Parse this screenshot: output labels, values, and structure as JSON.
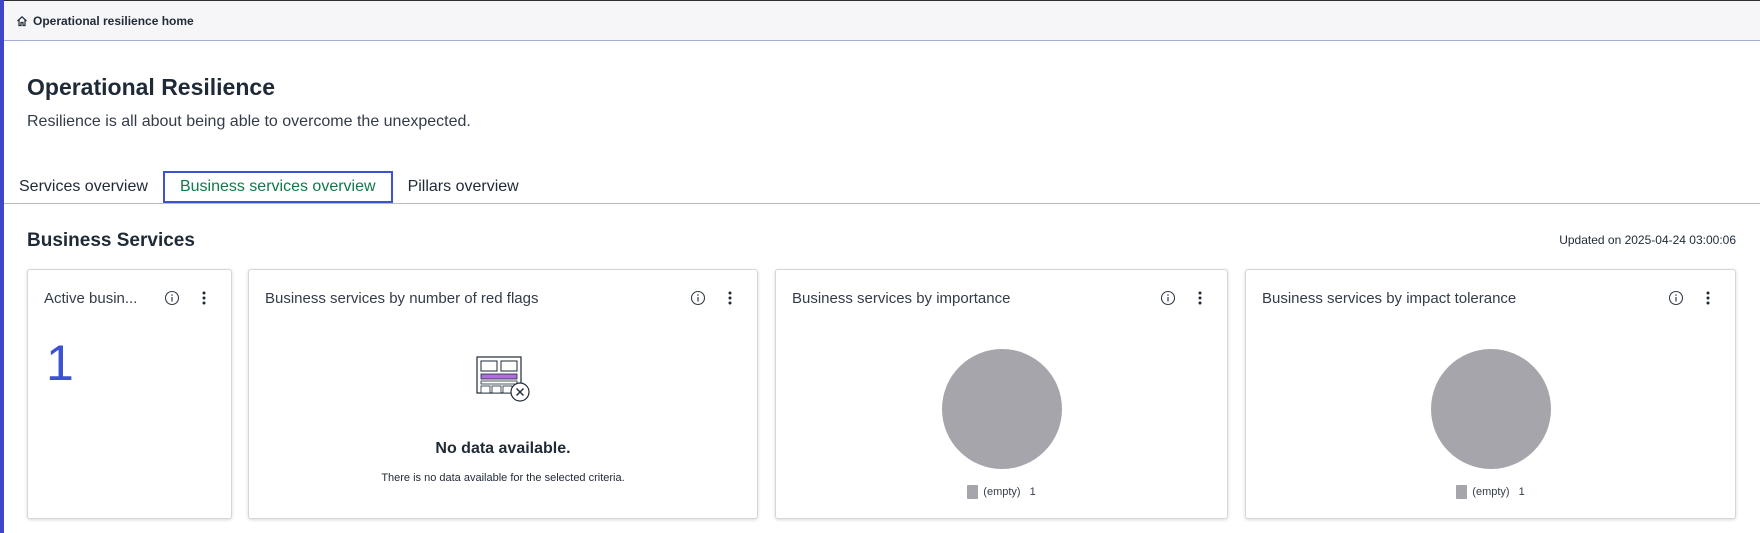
{
  "breadcrumb": {
    "label": "Operational resilience home"
  },
  "header": {
    "title": "Operational Resilience",
    "subtitle": "Resilience is all about being able to overcome the unexpected."
  },
  "tabs": [
    {
      "label": "Services overview",
      "active": false
    },
    {
      "label": "Business services overview",
      "active": true
    },
    {
      "label": "Pillars overview",
      "active": false
    }
  ],
  "section": {
    "title": "Business Services",
    "updated": "Updated on 2025-04-24 03:00:06"
  },
  "cards": {
    "active": {
      "title": "Active busin...",
      "value": "1"
    },
    "red_flags": {
      "title": "Business services by number of red flags",
      "empty_title": "No data available.",
      "empty_sub": "There is no data available for the selected criteria."
    },
    "importance": {
      "title": "Business services by importance",
      "legend_label": "(empty)",
      "legend_value": "1"
    },
    "impact": {
      "title": "Business services by impact tolerance",
      "legend_label": "(empty)",
      "legend_value": "1"
    }
  },
  "colors": {
    "accent": "#3c52d0",
    "active_tab_text": "#0e7a4a",
    "pie_empty": "#a5a5ab"
  },
  "chart_data": [
    {
      "type": "pie",
      "title": "Business services by importance",
      "categories": [
        "(empty)"
      ],
      "values": [
        1
      ]
    },
    {
      "type": "pie",
      "title": "Business services by impact tolerance",
      "categories": [
        "(empty)"
      ],
      "values": [
        1
      ]
    }
  ]
}
